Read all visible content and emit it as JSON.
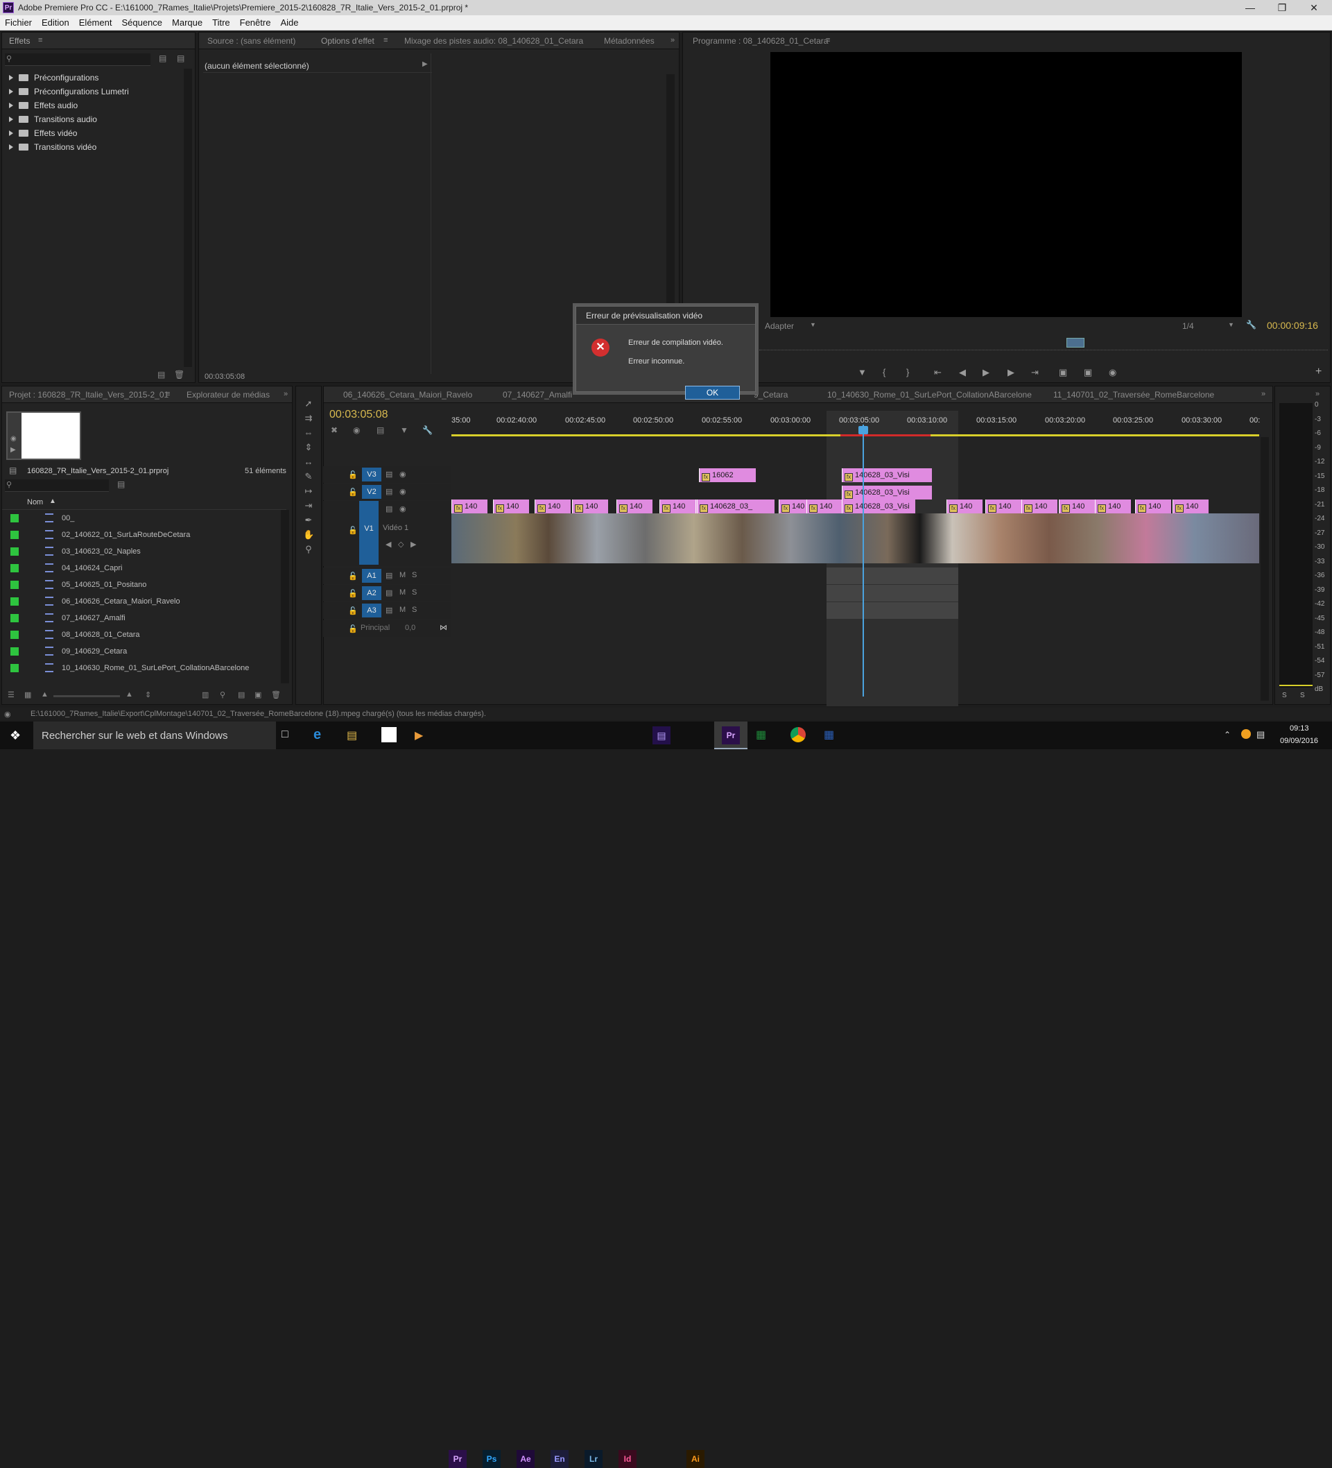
{
  "window": {
    "app_icon": "Pr",
    "title": "Adobe Premiere Pro CC - E:\\161000_7Rames_Italie\\Projets\\Premiere_2015-2\\160828_7R_Italie_Vers_2015-2_01.prproj *",
    "controls": [
      "minimize-icon",
      "maximize-icon",
      "close-icon"
    ]
  },
  "menu": [
    "Fichier",
    "Edition",
    "Elément",
    "Séquence",
    "Marque",
    "Titre",
    "Fenêtre",
    "Aide"
  ],
  "effects_panel": {
    "tab": "Effets",
    "items": [
      "Préconfigurations",
      "Préconfigurations Lumetri",
      "Effets audio",
      "Transitions audio",
      "Effets vidéo",
      "Transitions vidéo"
    ]
  },
  "source_panel": {
    "tabs": [
      "Source : (sans élément)",
      "Options d'effet",
      "Mixage des pistes audio: 08_140628_01_Cetara",
      "Métadonnées"
    ],
    "no_selection": "(aucun élément sélectionné)",
    "timecode": "00:03:05:08"
  },
  "program_monitor": {
    "tab": "Programme : 08_140628_01_Cetara",
    "fit": "Adapter",
    "resolution": "1/4",
    "timecode": "00:00:09:16"
  },
  "dialog": {
    "title": "Erreur de prévisualisation vidéo",
    "message": "Erreur de compilation vidéo.",
    "detail": "Erreur inconnue.",
    "ok": "OK"
  },
  "project_panel": {
    "tabs": [
      "Projet : 160828_7R_Italie_Vers_2015-2_01",
      "Explorateur de médias"
    ],
    "file": "160828_7R_Italie_Vers_2015-2_01.prproj",
    "count": "51 éléments",
    "column": "Nom",
    "items": [
      "00_",
      "02_140622_01_SurLaRouteDeCetara",
      "03_140623_02_Naples",
      "04_140624_Capri",
      "05_140625_01_Positano",
      "06_140626_Cetara_Maiori_Ravelo",
      "07_140627_Amalfi",
      "08_140628_01_Cetara",
      "09_140629_Cetara",
      "10_140630_Rome_01_SurLePort_CollationABarcelone"
    ]
  },
  "timeline": {
    "tabs": [
      "06_140626_Cetara_Maiori_Ravelo",
      "07_140627_Amalfi",
      "9_Cetara",
      "10_140630_Rome_01_SurLePort_CollationABarcelone",
      "11_140701_02_Traversée_RomeBarcelone"
    ],
    "timecode": "00:03:05:08",
    "ruler": [
      "35:00",
      "00:02:40:00",
      "00:02:45:00",
      "00:02:50:00",
      "00:02:55:00",
      "00:03:00:00",
      "00:03:05:00",
      "00:03:10:00",
      "00:03:15:00",
      "00:03:20:00",
      "00:03:25:00",
      "00:03:30:00",
      "00:"
    ],
    "video_tracks": [
      "V3",
      "V2",
      "V1"
    ],
    "v1_name": "Vidéo 1",
    "audio_tracks": [
      "A1",
      "A2",
      "A3"
    ],
    "master": "Principal",
    "master_value": "0,0",
    "clips": {
      "v3_a": "16062",
      "v3_b": "140628_03_Visi",
      "v2": "140628_03_Visi",
      "v1_main": "140628_03_",
      "v1_sel": "140628_03_Visi",
      "v1_short": [
        "140",
        "140",
        "140",
        "140",
        "140",
        "140",
        "140",
        "140",
        "140",
        "140",
        "140",
        "140",
        "140",
        "140",
        "140",
        "140",
        "140"
      ]
    }
  },
  "meter": {
    "labels": [
      "0",
      "-3",
      "-6",
      "-9",
      "-12",
      "-15",
      "-18",
      "-21",
      "-24",
      "-27",
      "-30",
      "-33",
      "-36",
      "-39",
      "-42",
      "-45",
      "-48",
      "-51",
      "-54",
      "-57",
      "dB"
    ],
    "solo": [
      "S",
      "S"
    ]
  },
  "status": "E:\\161000_7Rames_Italie\\Export\\CplMontage\\140701_02_Traversée_RomeBarcelone (18).mpeg chargé(s) (tous les médias chargés).",
  "taskbar": {
    "search": "Rechercher sur le web et dans Windows",
    "time": "09:13",
    "date": "09/09/2016",
    "apps": [
      "Pr",
      "Ps",
      "Ae",
      "En",
      "Lr",
      "Id",
      "Ai"
    ]
  },
  "colors": {
    "accent": "#1f5f99",
    "clip_pink": "#e08be0",
    "label_green": "#2ec43f",
    "error_red": "#d32f2f",
    "playhead_blue": "#4aa3df"
  }
}
